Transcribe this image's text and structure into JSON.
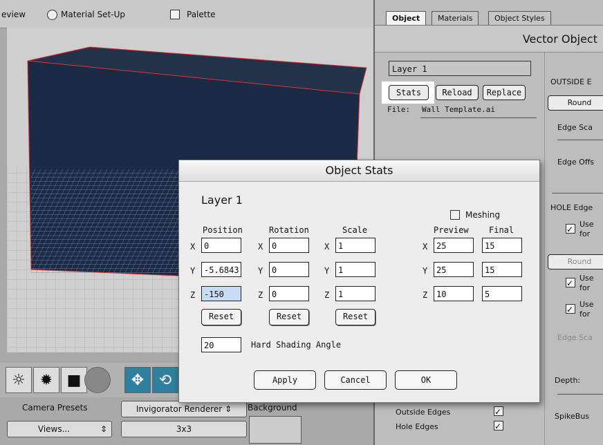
{
  "top_bar": {
    "preview_partial": "eview",
    "material_setup": "Material Set-Up",
    "palette": "Palette"
  },
  "left_panel": {
    "camera_presets": "Camera Presets",
    "views": "Views...",
    "renderer": "Invigorator Renderer",
    "background": "Background",
    "grid": "3x3"
  },
  "right_panel": {
    "tabs": [
      "Object",
      "Materials",
      "Object Styles"
    ],
    "header": "Vector Object",
    "layer_field": "Layer 1",
    "stats_btn": "Stats",
    "reload_btn": "Reload",
    "replace_btn": "Replace",
    "file_label": "File:",
    "file_name": "Wall Template.ai",
    "outside_edges_partial": "OUTSIDE E",
    "round_partial": "Round",
    "edge_scale_partial": "Edge Sca",
    "edge_offset_partial": "Edge Offs",
    "hole_edges_partial": "HOLE Edge",
    "use_for_1": "Use",
    "for_1": "for",
    "round_2": "Round",
    "use_for_2": "Use",
    "for_2": "for",
    "use_for_3": "Use",
    "for_3": "for",
    "edge_scale_2": "Edge Sca",
    "depth": "Depth:",
    "spikebus": "SpikeBus",
    "outside_edges": "Outside Edges",
    "hole_edges": "Hole Edges"
  },
  "dialog": {
    "title": "Object Stats",
    "layer": "Layer 1",
    "meshing": "Meshing",
    "headers": {
      "position": "Position",
      "rotation": "Rotation",
      "scale": "Scale",
      "preview": "Preview",
      "final": "Final"
    },
    "axes": [
      "X",
      "Y",
      "Z"
    ],
    "position": [
      "0",
      "-5.6843",
      "-150"
    ],
    "rotation": [
      "0",
      "0",
      "0"
    ],
    "scale": [
      "1",
      "1",
      "1"
    ],
    "preview": [
      "25",
      "25",
      "10"
    ],
    "final": [
      "15",
      "15",
      "5"
    ],
    "reset": "Reset",
    "hard_shading_value": "20",
    "hard_shading_label": "Hard Shading Angle",
    "apply": "Apply",
    "cancel": "Cancel",
    "ok": "OK"
  }
}
